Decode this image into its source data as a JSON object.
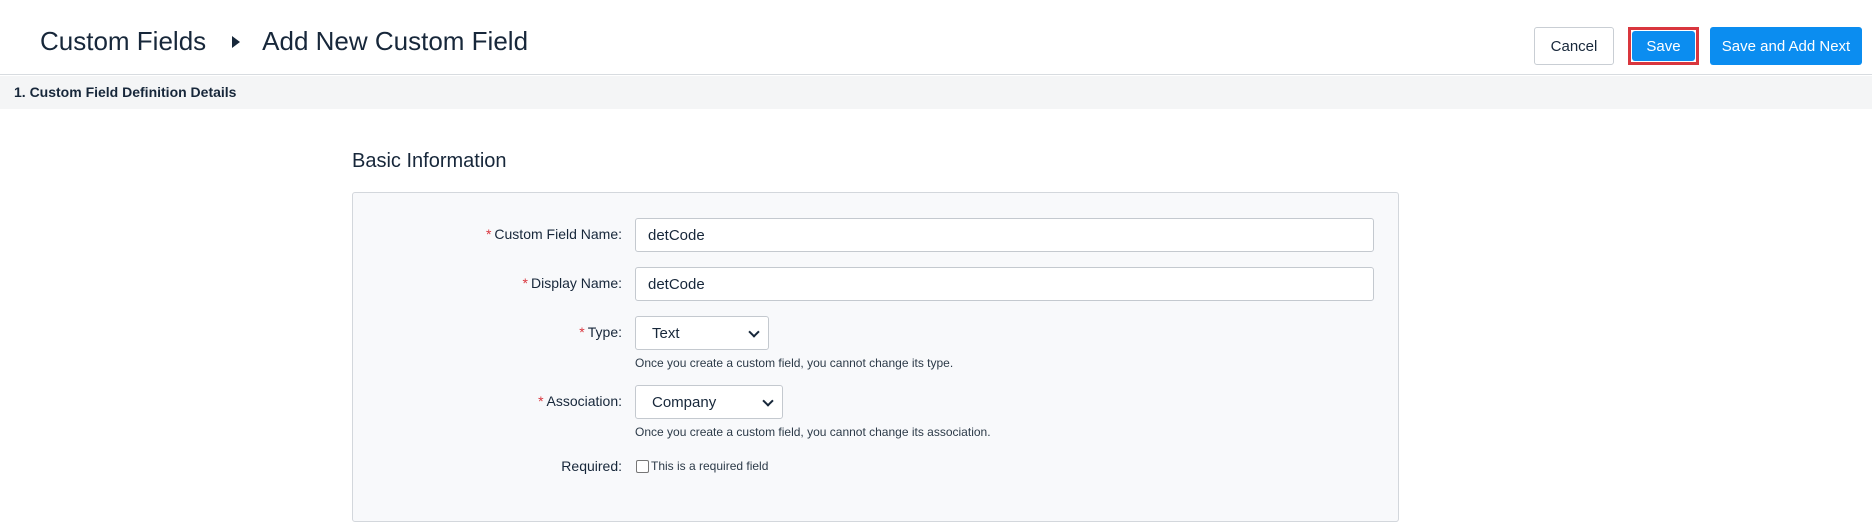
{
  "header": {
    "breadcrumb_parent": "Custom Fields",
    "breadcrumb_current": "Add New Custom Field",
    "cancel_label": "Cancel",
    "save_label": "Save",
    "save_next_label": "Save and Add Next"
  },
  "section": {
    "title": "1. Custom Field Definition Details"
  },
  "basic_info": {
    "title": "Basic Information",
    "fields": {
      "custom_field_name": {
        "label": "Custom Field Name:",
        "value": "detCode",
        "required": true
      },
      "display_name": {
        "label": "Display Name:",
        "value": "detCode",
        "required": true
      },
      "type": {
        "label": "Type:",
        "value": "Text",
        "required": true,
        "hint": "Once you create a custom field, you cannot change its type."
      },
      "association": {
        "label": "Association:",
        "value": "Company",
        "required": true,
        "hint": "Once you create a custom field, you cannot change its association."
      },
      "required": {
        "label": "Required:",
        "checkbox_label": "This is a required field",
        "checked": false
      }
    },
    "required_marker": "*"
  },
  "colors": {
    "primary": "#0b8df0",
    "required": "#d9363e",
    "text": "#17273a"
  }
}
